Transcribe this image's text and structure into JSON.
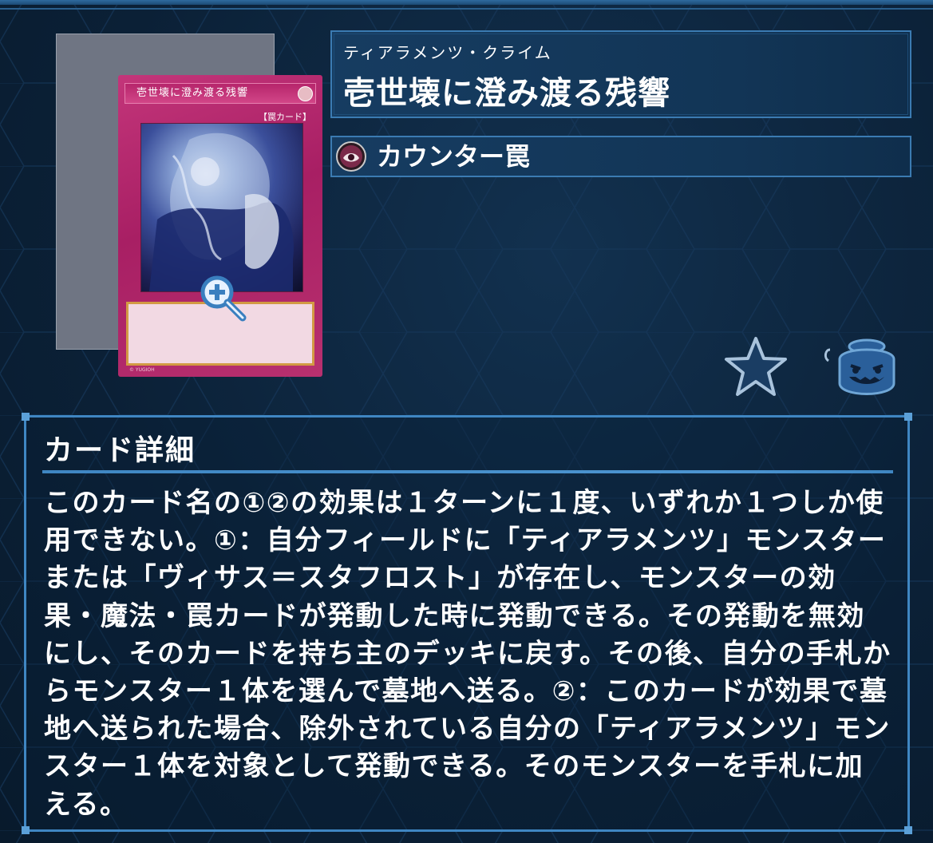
{
  "card": {
    "ruby": "ティアラメンツ・クライム",
    "name": "壱世壊に澄み渡る残響",
    "type": "カウンター罠",
    "art": {
      "name_bar": "壱世壊に澄み渡る残響",
      "type_label": "【罠カード】"
    }
  },
  "details": {
    "heading": "カード詳細",
    "text": "このカード名の①②の効果は１ターンに１度、いずれか１つしか使用できない。①：自分フィールドに「ティアラメンツ」モンスターまたは「ヴィサス＝スタフロスト」が存在し、モンスターの効果・魔法・罠カードが発動した時に発動できる。その発動を無効にし、そのカードを持ち主のデッキに戻す。その後、自分の手札からモンスター１体を選んで墓地へ送る。②：このカードが効果で墓地へ送られた場合、除外されている自分の「ティアラメンツ」モンスター１体を対象として発動できる。そのモンスターを手札に加える。"
  },
  "icons": {
    "zoom": "zoom-in-icon",
    "trap": "counter-trap-icon",
    "favorite": "star-icon",
    "jar": "pot-of-greed-icon"
  },
  "colors": {
    "background": "#0c2238",
    "panel_border": "#3b7bb2",
    "trap_card": "#b8306f",
    "text": "#ffffff"
  }
}
